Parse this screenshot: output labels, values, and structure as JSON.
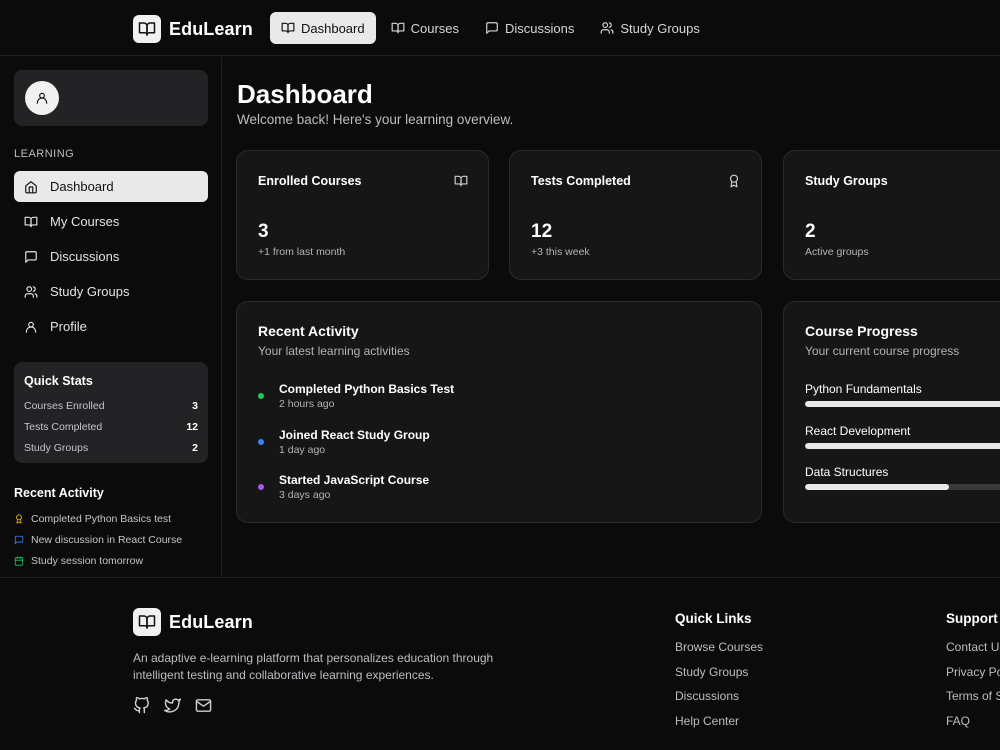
{
  "brand": {
    "name": "EduLearn",
    "icon": "book-open-icon"
  },
  "topnav": [
    {
      "label": "Dashboard",
      "icon": "book-open-icon",
      "active": true
    },
    {
      "label": "Courses",
      "icon": "book-open-icon"
    },
    {
      "label": "Discussions",
      "icon": "message-square-icon"
    },
    {
      "label": "Study Groups",
      "icon": "users-icon"
    }
  ],
  "sidebar": {
    "section_label": "LEARNING",
    "items": [
      {
        "label": "Dashboard",
        "icon": "home-icon",
        "active": true
      },
      {
        "label": "My Courses",
        "icon": "book-open-icon"
      },
      {
        "label": "Discussions",
        "icon": "message-square-icon"
      },
      {
        "label": "Study Groups",
        "icon": "users-icon"
      },
      {
        "label": "Profile",
        "icon": "user-icon"
      }
    ],
    "quick_stats": {
      "title": "Quick Stats",
      "rows": [
        {
          "label": "Courses Enrolled",
          "value": "3"
        },
        {
          "label": "Tests Completed",
          "value": "12"
        },
        {
          "label": "Study Groups",
          "value": "2"
        }
      ]
    },
    "recent": {
      "title": "Recent Activity",
      "items": [
        {
          "text": "Completed Python Basics test",
          "icon": "award-icon",
          "color": "#eab308"
        },
        {
          "text": "New discussion in React Course",
          "icon": "message-square-icon",
          "color": "#3b82f6"
        },
        {
          "text": "Study session tomorrow",
          "icon": "calendar-icon",
          "color": "#22c55e"
        }
      ]
    }
  },
  "main": {
    "title": "Dashboard",
    "subtitle": "Welcome back! Here's your learning overview.",
    "stats": [
      {
        "title": "Enrolled Courses",
        "value": "3",
        "sub": "+1 from last month",
        "icon": "book-open-icon"
      },
      {
        "title": "Tests Completed",
        "value": "12",
        "sub": "+3 this week",
        "icon": "award-icon"
      },
      {
        "title": "Study Groups",
        "value": "2",
        "sub": "Active groups",
        "icon": "users-icon"
      }
    ],
    "activity": {
      "title": "Recent Activity",
      "subtitle": "Your latest learning activities",
      "items": [
        {
          "title": "Completed Python Basics Test",
          "time": "2 hours ago",
          "color": "#22c55e"
        },
        {
          "title": "Joined React Study Group",
          "time": "1 day ago",
          "color": "#3b82f6"
        },
        {
          "title": "Started JavaScript Course",
          "time": "3 days ago",
          "color": "#a855f7"
        }
      ]
    },
    "progress": {
      "title": "Course Progress",
      "subtitle": "Your current course progress",
      "items": [
        {
          "name": "Python Fundamentals",
          "percent": 100
        },
        {
          "name": "React Development",
          "percent": 100
        },
        {
          "name": "Data Structures",
          "percent": 72
        }
      ]
    }
  },
  "footer": {
    "description": "An adaptive e-learning platform that personalizes education through intelligent testing and collaborative learning experiences.",
    "social": [
      "github-icon",
      "twitter-icon",
      "mail-icon"
    ],
    "quick_links": {
      "title": "Quick Links",
      "links": [
        "Browse Courses",
        "Study Groups",
        "Discussions",
        "Help Center"
      ]
    },
    "support": {
      "title": "Support",
      "links": [
        "Contact Us",
        "Privacy Policy",
        "Terms of Service",
        "FAQ"
      ]
    }
  }
}
